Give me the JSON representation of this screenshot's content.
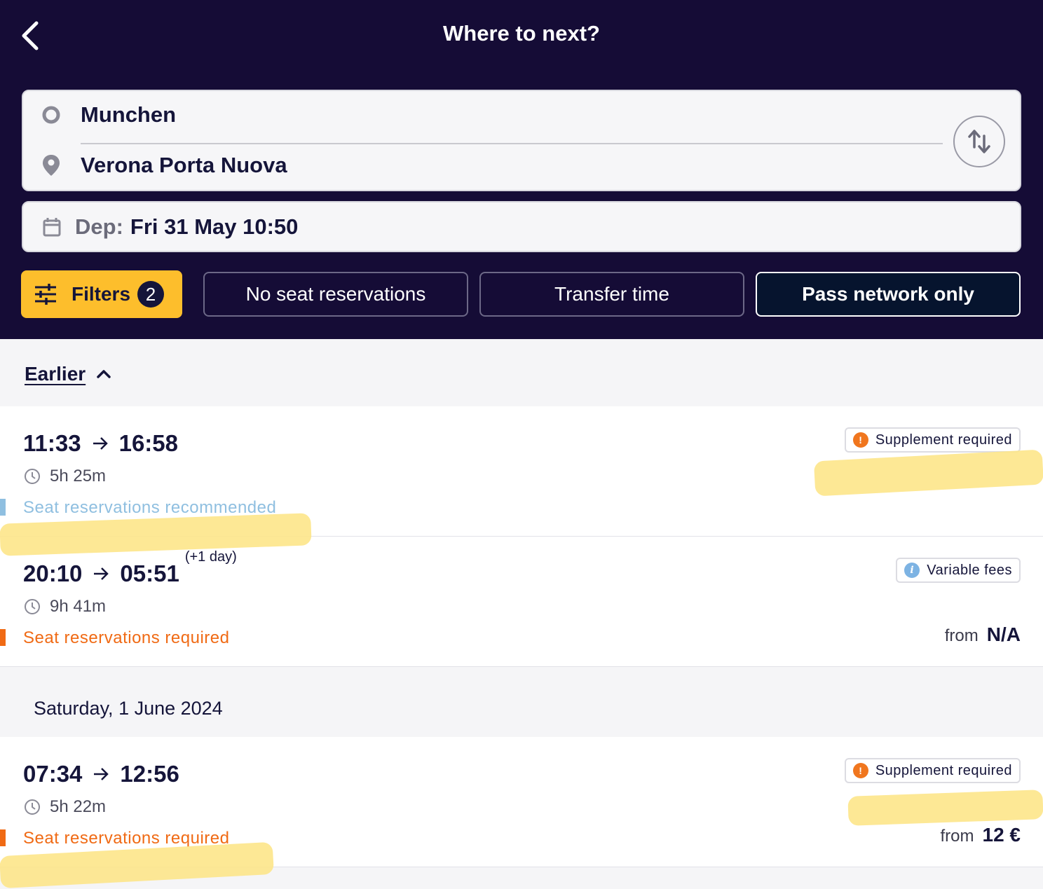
{
  "header": {
    "title": "Where to next?",
    "back_icon": "chevron-left-icon"
  },
  "route": {
    "from": "Munchen",
    "to": "Verona Porta Nuova"
  },
  "departure": {
    "label": "Dep:",
    "value": "Fri 31 May 10:50"
  },
  "filters": {
    "label": "Filters",
    "count": "2",
    "chips": [
      {
        "label": "No seat reservations",
        "selected": false
      },
      {
        "label": "Transfer time",
        "selected": false
      },
      {
        "label": "Pass network only",
        "selected": true
      }
    ]
  },
  "earlier": {
    "label": "Earlier"
  },
  "journeys": [
    {
      "dep": "11:33",
      "arr": "16:58",
      "plus_day": "",
      "duration": "5h 25m",
      "seat_note": "Seat reservations recommended",
      "seat_status": "recommended",
      "tag": "Supplement required",
      "tag_type": "warning",
      "price_from": "",
      "price": ""
    },
    {
      "dep": "20:10",
      "arr": "05:51",
      "plus_day": "(+1 day)",
      "duration": "9h 41m",
      "seat_note": "Seat reservations required",
      "seat_status": "required",
      "tag": "Variable fees",
      "tag_type": "info",
      "price_from": "from",
      "price": "N/A"
    },
    {
      "dep": "07:34",
      "arr": "12:56",
      "plus_day": "",
      "duration": "5h 22m",
      "seat_note": "Seat reservations required",
      "seat_status": "required",
      "tag": "Supplement required",
      "tag_type": "warning",
      "price_from": "from",
      "price": "12 €"
    }
  ],
  "day_header": "Saturday, 1 June 2024",
  "colors": {
    "header_bg": "#150c36",
    "accent_yellow": "#fdbe2c",
    "required_orange": "#f06a14",
    "recommended_blue": "#8fbfe0",
    "highlighter": "#fde68a"
  }
}
